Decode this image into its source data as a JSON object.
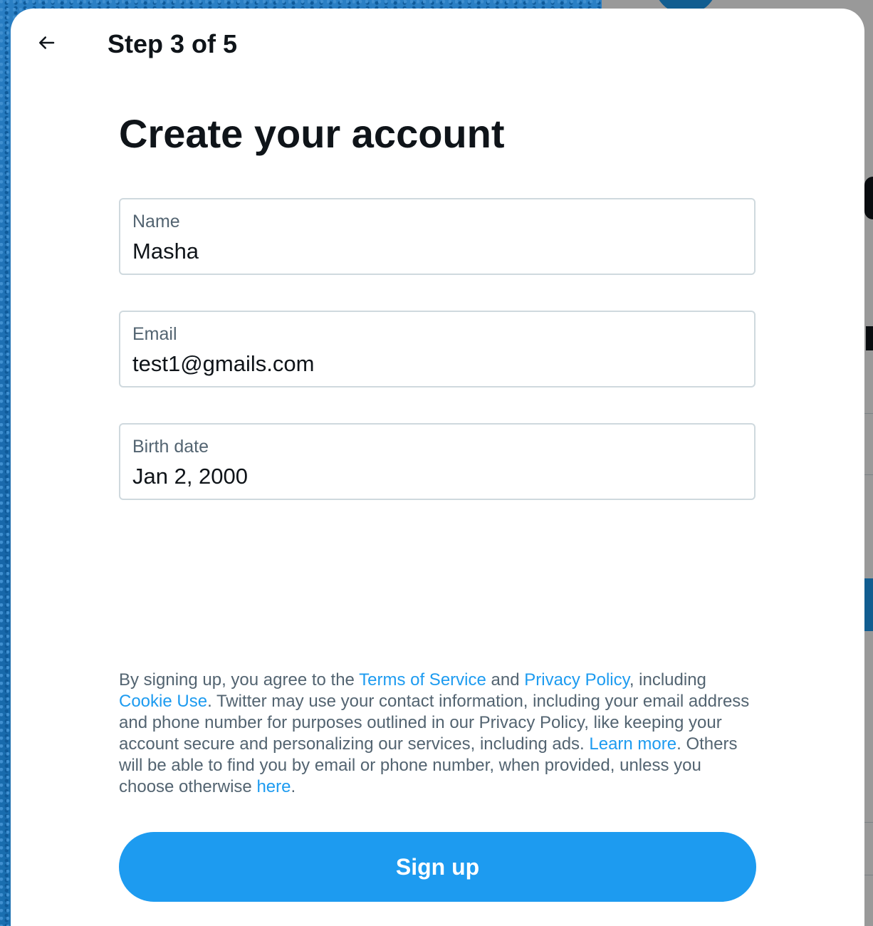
{
  "header": {
    "back_label": "Back",
    "step": "Step 3 of 5"
  },
  "title": "Create your account",
  "fields": [
    {
      "label": "Name",
      "value": "Masha"
    },
    {
      "label": "Email",
      "value": "test1@gmails.com"
    },
    {
      "label": "Birth date",
      "value": "Jan 2, 2000"
    }
  ],
  "legal": {
    "part1": "By signing up, you agree to the ",
    "tos_link": "Terms of Service",
    "part2": " and ",
    "privacy_link": "Privacy Policy",
    "part3": ", including ",
    "cookie_link": "Cookie Use",
    "part4": ". Twitter may use your contact information, including your email address and phone number for purposes outlined in our Privacy Policy, like keeping your account secure and personalizing our services, including ads. ",
    "learn_more_link": "Learn more",
    "part5": ". Others will be able to find you by email or phone number, when provided, unless you choose otherwise ",
    "here_link": "here",
    "part6": "."
  },
  "signup_button": "Sign up",
  "colors": {
    "accent": "#1d9bf0",
    "text_primary": "#0f1419",
    "text_secondary": "#536471",
    "border": "#cfd9de"
  },
  "icons": {
    "back": "arrow-left-icon"
  }
}
